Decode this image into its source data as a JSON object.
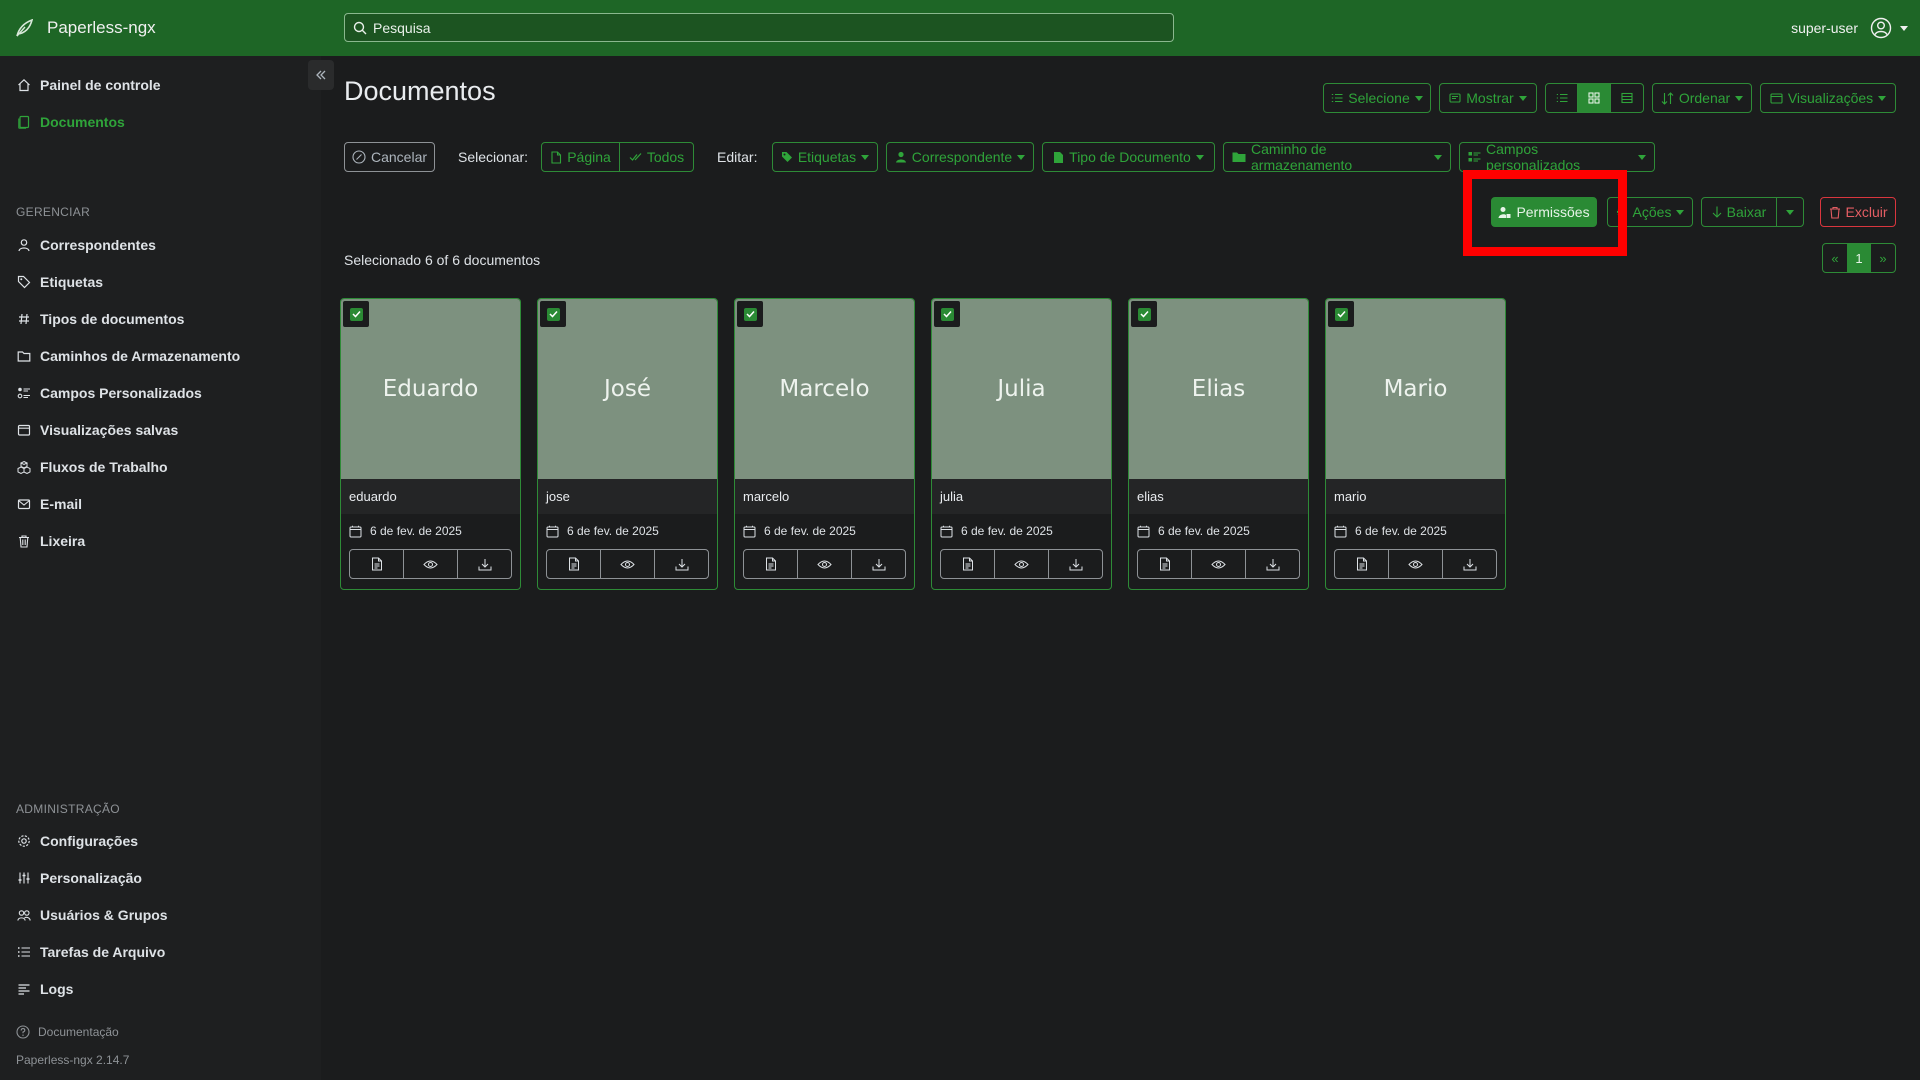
{
  "app": {
    "brand": "Paperless-ngx",
    "version": "Paperless-ngx 2.14.7"
  },
  "search": {
    "placeholder": "Pesquisa"
  },
  "user": {
    "name": "super-user"
  },
  "sidebar": {
    "main_items": [
      {
        "label": "Painel de controle",
        "icon": "house-icon"
      },
      {
        "label": "Documentos",
        "icon": "documents-icon",
        "active": true
      }
    ],
    "manage_label": "GERENCIAR",
    "manage_items": [
      {
        "label": "Correspondentes",
        "icon": "person-icon"
      },
      {
        "label": "Etiquetas",
        "icon": "tags-icon"
      },
      {
        "label": "Tipos de documentos",
        "icon": "hash-icon"
      },
      {
        "label": "Caminhos de Armazenamento",
        "icon": "folder-icon"
      },
      {
        "label": "Campos Personalizados",
        "icon": "ui-radios-icon"
      },
      {
        "label": "Visualizações salvas",
        "icon": "window-stack-icon"
      },
      {
        "label": "Fluxos de Trabalho",
        "icon": "boxes-icon"
      },
      {
        "label": "E-mail",
        "icon": "envelope-icon"
      },
      {
        "label": "Lixeira",
        "icon": "trash-icon"
      }
    ],
    "admin_label": "ADMINISTRAÇÃO",
    "admin_items": [
      {
        "label": "Configurações",
        "icon": "gear-icon"
      },
      {
        "label": "Personalização",
        "icon": "sliders-icon"
      },
      {
        "label": "Usuários & Grupos",
        "icon": "people-icon"
      },
      {
        "label": "Tarefas de Arquivo",
        "icon": "list-task-icon"
      },
      {
        "label": "Logs",
        "icon": "text-lines-icon"
      }
    ],
    "docs_link": "Documentação"
  },
  "page": {
    "title": "Documentos",
    "selected_info": "Selecionado 6 of 6 documentos"
  },
  "toolbar": {
    "select_label": "Selecione",
    "show_label": "Mostrar",
    "sort_label": "Ordenar",
    "views_label": "Visualizações",
    "cancel_label": "Cancelar",
    "selecionar_label": "Selecionar:",
    "page_label": "Página",
    "all_label": "Todos",
    "edit_label": "Editar:",
    "tags_label": "Etiquetas",
    "correspondent_label": "Correspondente",
    "doctype_label": "Tipo de Documento",
    "storage_label": "Caminho de armazenamento",
    "custom_fields_label": "Campos personalizados",
    "permissions_label": "Permissões",
    "actions_label": "Ações",
    "download_label": "Baixar",
    "delete_label": "Excluir"
  },
  "pagination": {
    "prev": "«",
    "current": "1",
    "next": "»"
  },
  "documents": [
    {
      "thumb_text": "Eduardo",
      "title": "eduardo",
      "date": "6 de fev. de 2025"
    },
    {
      "thumb_text": "José",
      "title": "jose",
      "date": "6 de fev. de 2025"
    },
    {
      "thumb_text": "Marcelo",
      "title": "marcelo",
      "date": "6 de fev. de 2025"
    },
    {
      "thumb_text": "Julia",
      "title": "julia",
      "date": "6 de fev. de 2025"
    },
    {
      "thumb_text": "Elias",
      "title": "elias",
      "date": "6 de fev. de 2025"
    },
    {
      "thumb_text": "Mario",
      "title": "mario",
      "date": "6 de fev. de 2025"
    }
  ],
  "colors": {
    "topbar": "#1e6626",
    "accent": "#2fa43a",
    "danger": "#e35d63",
    "highlight": "#ff0000"
  }
}
